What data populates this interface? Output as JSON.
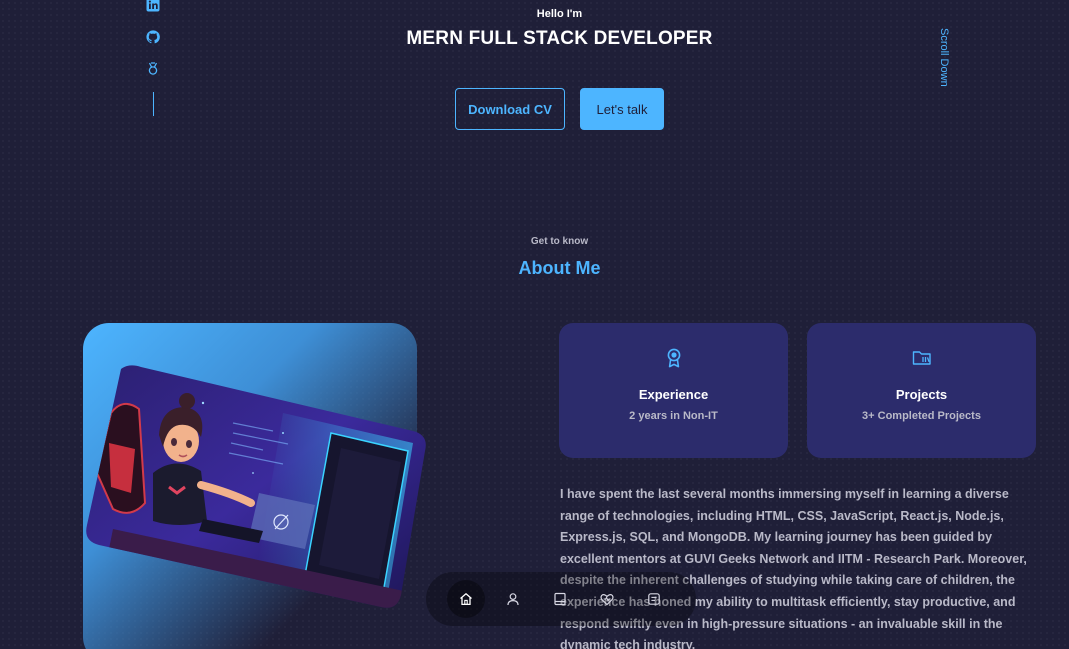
{
  "socials": [
    {
      "icon": "linkedin-icon"
    },
    {
      "icon": "github-icon"
    },
    {
      "icon": "badge-icon"
    }
  ],
  "header": {
    "greeting": "Hello I'm",
    "title": "MERN FULL STACK DEVELOPER",
    "download_cv_label": "Download CV",
    "lets_talk_label": "Let's talk",
    "scroll_down_label": "Scroll Down"
  },
  "about": {
    "kicker": "Get to know",
    "title": "About Me",
    "cards": [
      {
        "icon": "award-icon",
        "title": "Experience",
        "subtitle": "2 years in Non-IT"
      },
      {
        "icon": "folder-icon",
        "title": "Projects",
        "subtitle": "3+ Completed Projects"
      }
    ],
    "bio": "I have spent the last several months immersing myself in learning a diverse range of technologies, including HTML, CSS, JavaScript, React.js, Node.js, Express.js, SQL, and MongoDB. My learning journey has been guided by excellent mentors at GUVI Geeks Network and IITM - Research Park. Moreover, despite the inherent challenges of studying while taking care of children, the experience has honed my ability to multitask efficiently, stay productive, and respond swiftly even in high-pressure situations - an invaluable skill in the dynamic tech industry."
  },
  "nav": [
    {
      "icon": "home-icon",
      "active": true
    },
    {
      "icon": "user-icon",
      "active": false
    },
    {
      "icon": "book-icon",
      "active": false
    },
    {
      "icon": "services-icon",
      "active": false
    },
    {
      "icon": "message-icon",
      "active": false
    }
  ],
  "colors": {
    "background": "#1f1f38",
    "accent": "#4db5ff",
    "card": "#2c2c6c",
    "muted_text": "#b9b9c8"
  }
}
